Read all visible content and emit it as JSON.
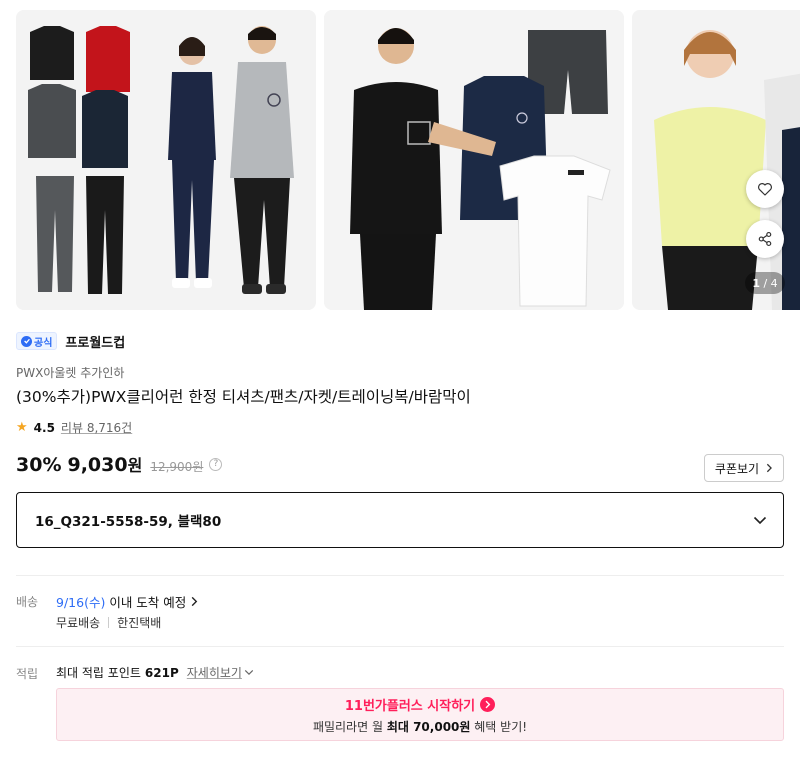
{
  "gallery": {
    "counter_current": "1",
    "counter_total": "/ 4",
    "icons": {
      "wishlist": "heart-icon",
      "share": "share-icon"
    }
  },
  "brand": {
    "badge_label": "공식",
    "name": "프로월드컵"
  },
  "store_name": "PWX아울렛 추가인하",
  "product_title": "(30%추가)PWX클리어런 한정 티셔츠/팬츠/자켓/트레이닝복/바람막이",
  "rating": {
    "score": "4.5",
    "review_text": "리뷰 8,716건"
  },
  "price": {
    "discount": "30%",
    "sale_price": "9,030",
    "currency": "원",
    "original_price": "12,900원"
  },
  "coupon_button": "쿠폰보기",
  "option": {
    "selected": "16_Q321-5558-59, 블랙80"
  },
  "shipping": {
    "label": "배송",
    "date": "9/16(수)",
    "eta_text": "이내 도착 예정",
    "fee": "무료배송",
    "carrier": "한진택배"
  },
  "points": {
    "label": "적립",
    "prefix": "최대 적립 포인트",
    "amount": "621P",
    "detail_link": "자세히보기"
  },
  "plus_banner": {
    "title": "11번가플러스 시작하기",
    "desc_pre": "패밀리라면 월",
    "desc_bold": "최대 70,000원",
    "desc_post": "혜택 받기!"
  },
  "colors": {
    "accent_blue": "#2d6cf5",
    "plus_red": "#ff1f5a",
    "star": "#f5a623"
  }
}
